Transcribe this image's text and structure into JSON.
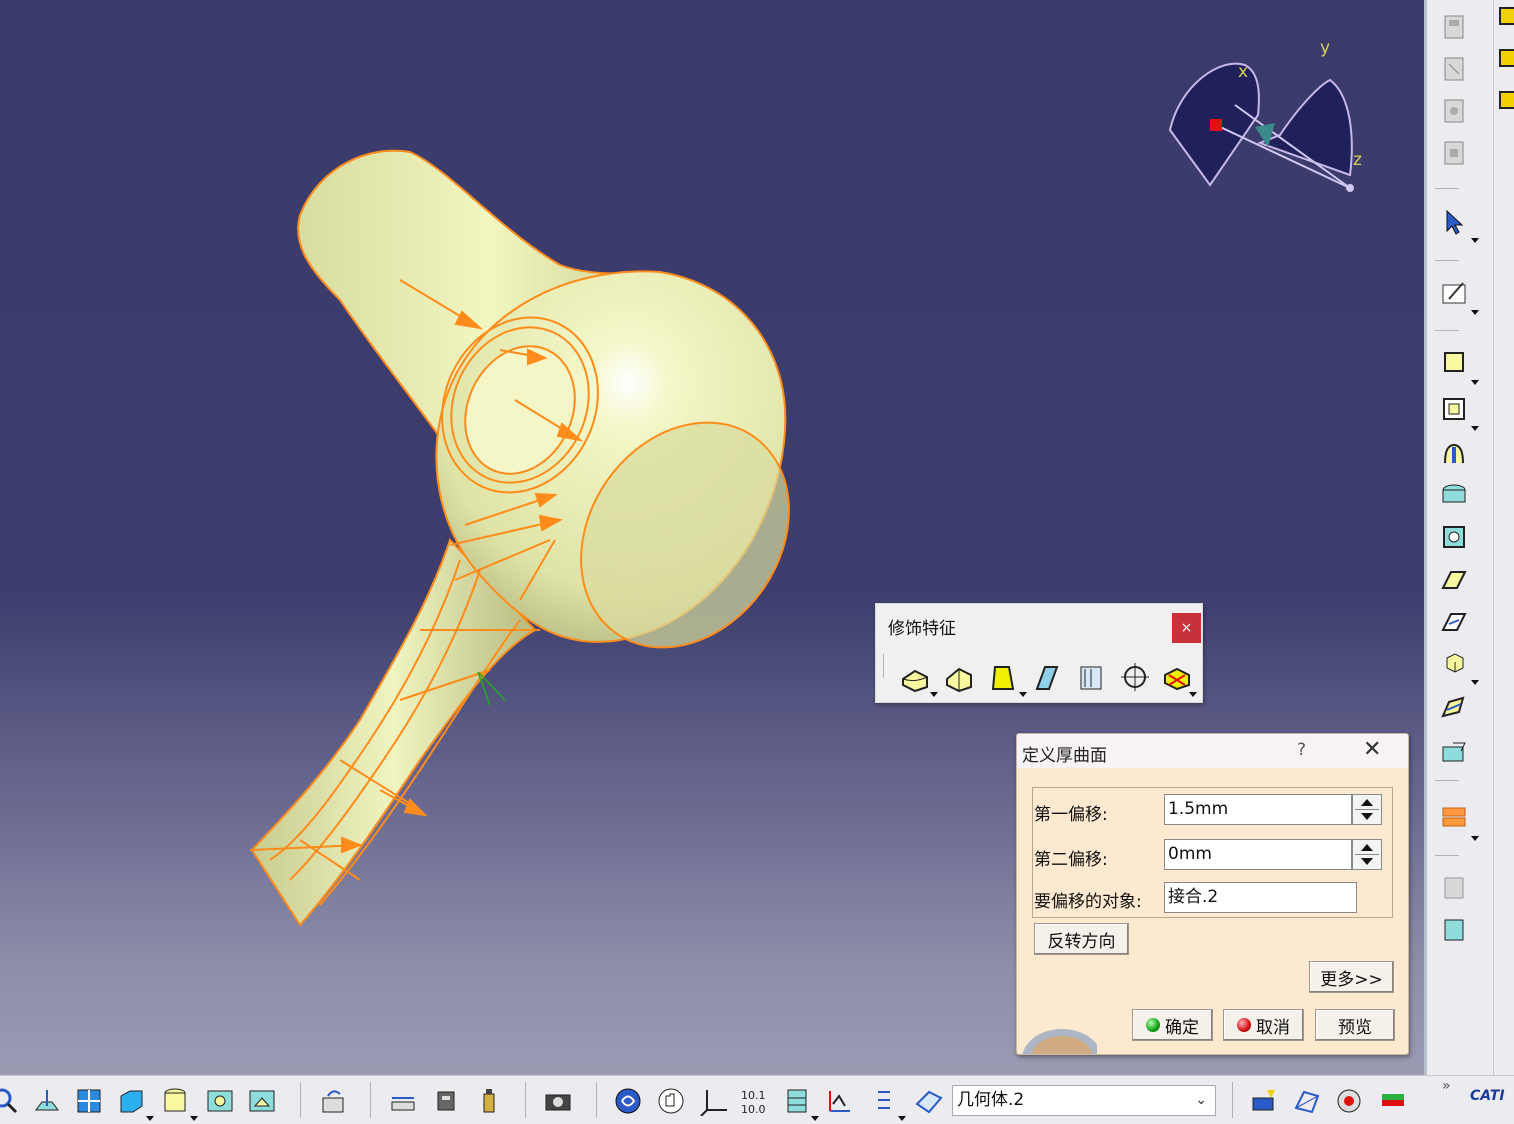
{
  "compass": {
    "x_label": "x",
    "y_label": "y",
    "z_label": "z"
  },
  "float_toolbar": {
    "title": "修饰特征",
    "close_label": "×",
    "icons": [
      "fillet-icon",
      "chamfer-icon",
      "draft-icon",
      "shell-icon",
      "thickness-icon",
      "thread-icon",
      "remove-face-icon"
    ]
  },
  "dialog": {
    "title": "定义厚曲面",
    "help": "?",
    "close": "✕",
    "first_offset_label": "第一偏移:",
    "first_offset_value": "1.5mm",
    "second_offset_label": "第二偏移:",
    "second_offset_value": "0mm",
    "object_label": "要偏移的对象:",
    "object_value": "接合.2",
    "reverse_button": "反转方向",
    "more_button": "更多>>",
    "ok_button": "确定",
    "cancel_button": "取消",
    "preview_button": "预览"
  },
  "bottom_toolbar": {
    "body_combo_value": "几何体.2",
    "brand": "CATI"
  },
  "colors": {
    "viewport_top": "#3a3a6b",
    "model_fill": "#ecf0b0",
    "edge_orange": "#ff8c1a",
    "dialog_bg": "#fce9cf",
    "close_red": "#c8303a"
  }
}
